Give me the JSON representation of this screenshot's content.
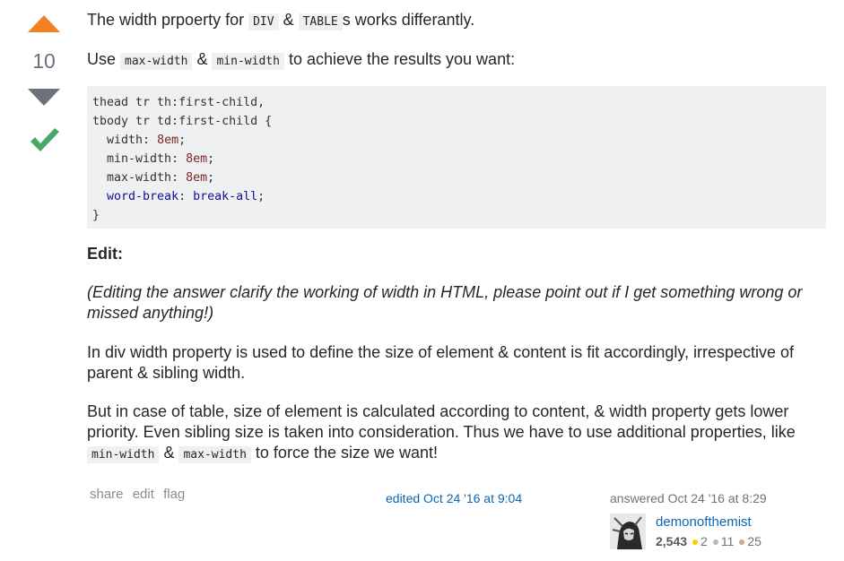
{
  "vote": {
    "count": "10"
  },
  "post": {
    "line1": {
      "pre": "The width prpoerty for ",
      "code1": "DIV",
      "mid": " & ",
      "code2": "TABLE",
      "post": "s works differantly."
    },
    "line2": {
      "pre": "Use ",
      "code1": "max-width",
      "mid": " & ",
      "code2": "min-width",
      "post": " to achieve the results you want:"
    },
    "code": {
      "l1": "thead tr th:first-child,",
      "l2": "tbody tr td:first-child {",
      "l3_prop": "width",
      "l3_val": "8em",
      "l4_prop": "min-width",
      "l4_val": "8em",
      "l5_prop": "max-width",
      "l5_val": "8em",
      "l6_prop": "word-break",
      "l6_val": "break-all",
      "l7": "}"
    },
    "edit_heading": "Edit:",
    "edit_note": "(Editing the answer clarify the working of width in HTML, please point out if I get something wrong or missed anything!)",
    "para_div": "In div width property is used to define the size of element & content is fit accordingly, irrespective of parent & sibling width.",
    "para_table": {
      "text": "But in case of table, size of element is calculated according to content, & width property gets lower priority. Even sibling size is taken into consideration. Thus we have to use additional properties, like ",
      "code1": "min-width",
      "mid": " & ",
      "code2": "max-width",
      "post": " to force the size we want!"
    }
  },
  "menu": {
    "share": "share",
    "edit": "edit",
    "flag": "flag"
  },
  "edited": "edited Oct 24 '16 at 9:04",
  "answered": "answered Oct 24 '16 at 8:29",
  "user": {
    "name": "demonofthemist",
    "reputation": "2,543",
    "gold": "2",
    "silver": "11",
    "bronze": "25"
  },
  "colors": {
    "upvote": "#f48024",
    "downvote": "#6a737c",
    "accepted": "#48a868",
    "link": "#0c65b1"
  }
}
